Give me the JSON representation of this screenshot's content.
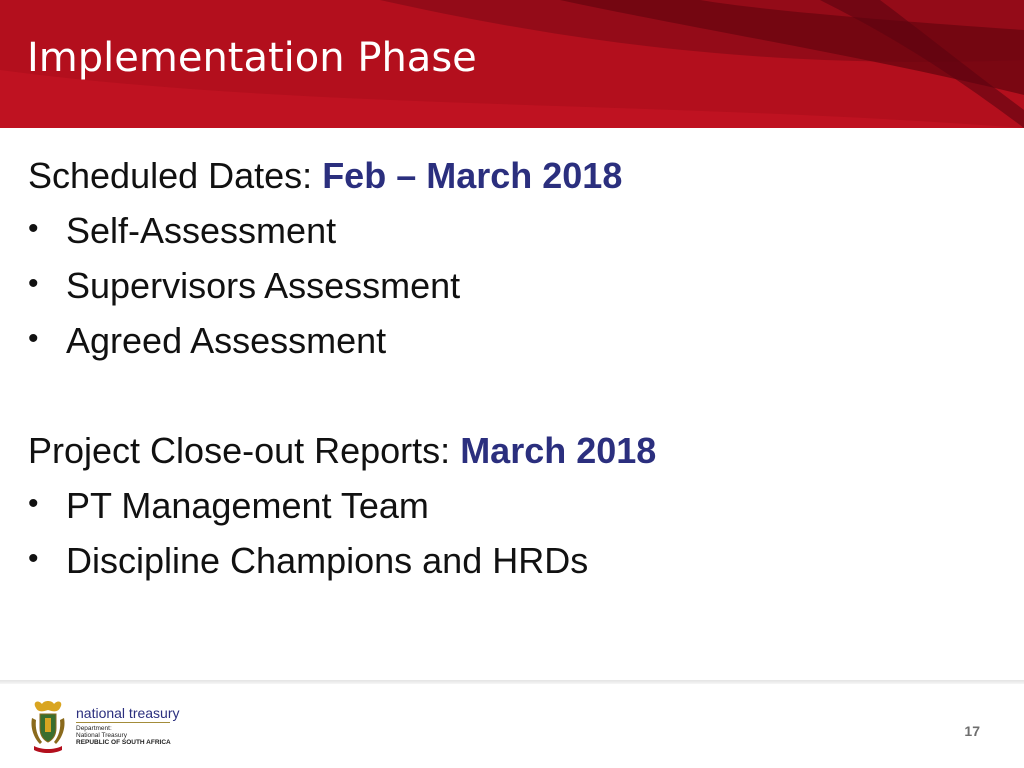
{
  "slide": {
    "title": "Implementation Phase",
    "sections": [
      {
        "label": "Scheduled Dates: ",
        "highlight": "Feb – March 2018",
        "bullets": [
          "Self-Assessment",
          "Supervisors Assessment",
          "Agreed Assessment"
        ]
      },
      {
        "label": "Project Close-out Reports: ",
        "highlight": "March 2018",
        "bullets": [
          "PT Management Team",
          "Discipline Champions and HRDs"
        ]
      }
    ],
    "bullet_symbol": "•"
  },
  "footer": {
    "logo": {
      "icon": "coat-of-arms-icon",
      "wordmark": "national treasury",
      "line1": "Department:",
      "line2": "National Treasury",
      "line3": "REPUBLIC OF SOUTH AFRICA"
    },
    "page_number": "17"
  },
  "colors": {
    "banner": "#b30f1d",
    "banner_dark": "#7a0611",
    "highlight": "#2b2f7e",
    "body_text": "#111111"
  }
}
